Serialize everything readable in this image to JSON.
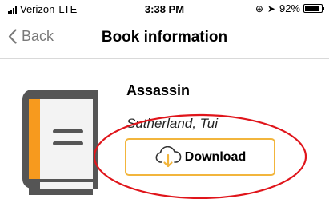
{
  "status_bar": {
    "carrier": "Verizon",
    "network": "LTE",
    "time": "3:38 PM",
    "battery_percent": "92%",
    "battery_level": 0.92,
    "icons": [
      "signal-icon",
      "lock-rotation-icon",
      "location-icon",
      "battery-icon"
    ]
  },
  "nav": {
    "back_label": "Back",
    "title": "Book information"
  },
  "book": {
    "title": "Assassin",
    "author": "Sutherland, Tui",
    "download_label": "Download",
    "icons": [
      "book-icon",
      "cloud-download-icon"
    ]
  },
  "colors": {
    "accent": "#f2b53c",
    "book_spine": "#f79a1e",
    "book_body": "#555555",
    "annotation": "#e0151b",
    "back_text": "#7a7a7a"
  }
}
